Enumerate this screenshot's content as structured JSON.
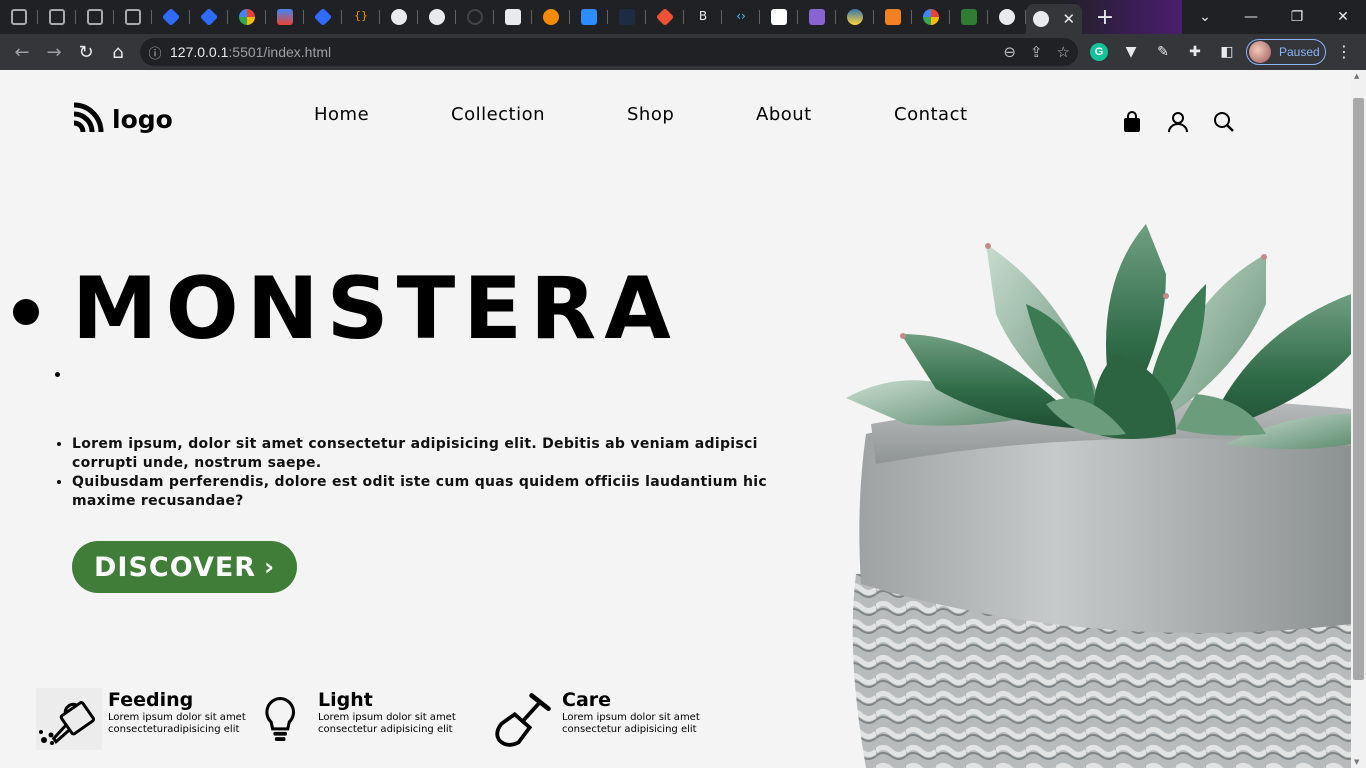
{
  "browser": {
    "url_host": "127.0.0.1",
    "url_path": ":5501/index.html",
    "profile_label": "Paused",
    "tab_close": "✕",
    "new_tab": "+"
  },
  "header": {
    "logo_text": "logo",
    "nav": [
      "Home",
      "Collection",
      "Shop",
      "About",
      "Contact"
    ]
  },
  "hero": {
    "title": "MONSTERA",
    "lines": [
      "Lorem ipsum, dolor sit amet consectetur adipisicing elit. Debitis ab veniam adipisci corrupti unde, nostrum saepe.",
      "Quibusdam perferendis, dolore est odit iste cum quas quidem officiis laudantium hic maxime recusandae?"
    ],
    "cta": "DISCOVER",
    "cta_chevron": "›"
  },
  "features": [
    {
      "title": "Feeding",
      "text": "Lorem ipsum dolor sit amet consecteturadipisicing elit",
      "icon": "watering-can-icon"
    },
    {
      "title": "Light",
      "text": "Lorem ipsum dolor sit amet consectetur adipisicing elit",
      "icon": "light-bulb-icon"
    },
    {
      "title": "Care",
      "text": "Lorem ipsum dolor sit amet consectetur adipisicing elit",
      "icon": "shovel-icon"
    }
  ],
  "colors": {
    "accent": "#3f7d39",
    "page_bg": "#f4f4f4",
    "chrome_bg": "#202124"
  }
}
